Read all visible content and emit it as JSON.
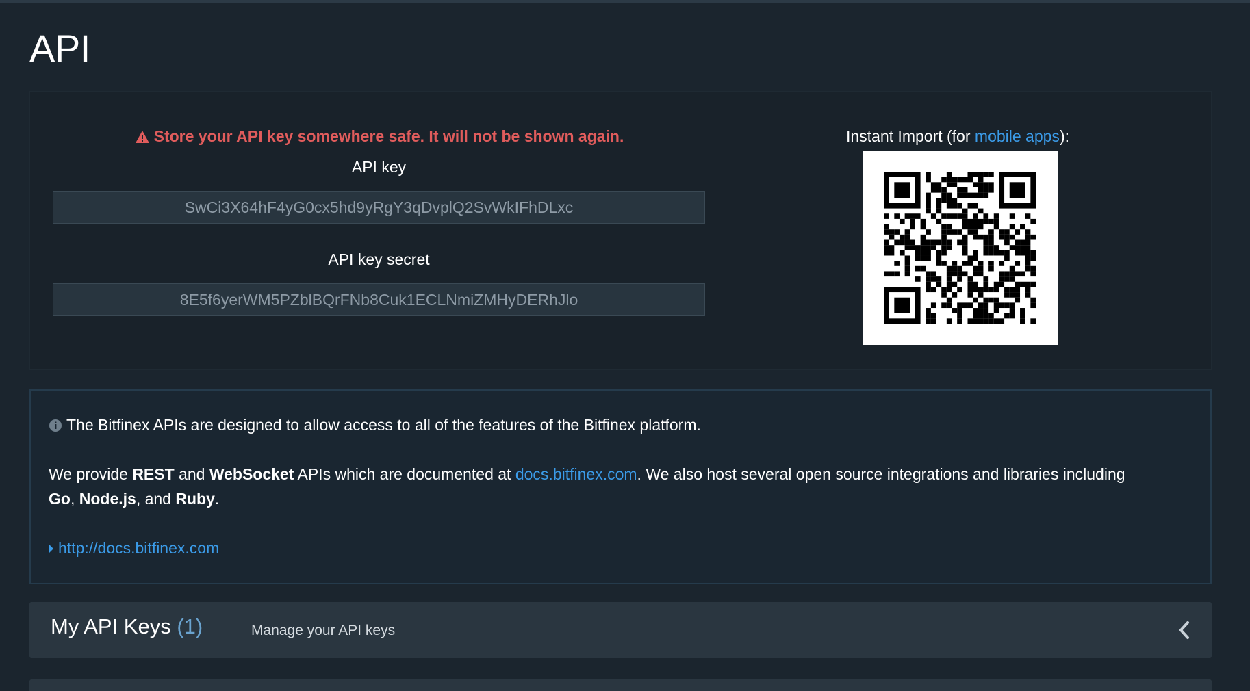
{
  "page": {
    "title": "API"
  },
  "key_panel": {
    "warning_text": "Store your API key somewhere safe. It will not be shown again.",
    "warning_color": "#e05c5c",
    "api_key_label": "API key",
    "api_key_value": "SwCi3X64hF4yG0cx5hd9yRgY3qDvplQ2SvWkIFhDLxc",
    "api_secret_label": "API key secret",
    "api_secret_value": "8E5f6yerWM5PZblBQrFNb8Cuk1ECLNmiZMHyDERhJlo",
    "import_prefix": "Instant Import (for ",
    "import_link": "mobile apps",
    "import_suffix": "):"
  },
  "info_panel": {
    "intro": "The Bitfinex APIs are designed to allow access to all of the features of the Bitfinex platform.",
    "p1_a": "We provide ",
    "p1_rest": "REST",
    "p1_and": " and ",
    "p1_ws": "WebSocket",
    "p1_b": " APIs which are documented at ",
    "p1_link": "docs.bitfinex.com",
    "p1_c": ". We also host several open source integrations and libraries including",
    "p2_go": "Go",
    "p2_sep1": ", ",
    "p2_node": "Node.js",
    "p2_sep2": ", and ",
    "p2_ruby": "Ruby",
    "p2_end": ".",
    "docs_url": "http://docs.bitfinex.com"
  },
  "my_keys": {
    "title": "My API Keys",
    "count": "(1)",
    "subtitle": "Manage your API keys"
  },
  "colors": {
    "background": "#1b252e",
    "link": "#3b9be8",
    "panel": "#2a3640"
  },
  "icons": {
    "warning": "warning-triangle-icon",
    "info": "info-circle-icon",
    "caret": "caret-right-icon",
    "collapse": "chevron-left-icon"
  }
}
